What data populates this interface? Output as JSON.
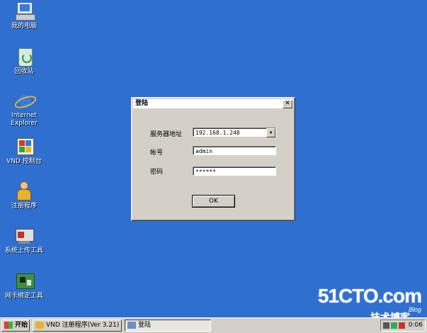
{
  "desktop": {
    "icons": [
      {
        "label": "我的电脑",
        "icon": "my-computer-icon"
      },
      {
        "label": "回收站",
        "icon": "recycle-bin-icon"
      },
      {
        "label": "Internet\nExplorer",
        "icon": "internet-explorer-icon"
      },
      {
        "label": "VND 控制台",
        "icon": "control-console-icon"
      },
      {
        "label": "注册程序",
        "icon": "register-program-icon"
      },
      {
        "label": "系统上传工具",
        "icon": "system-upload-tool-icon"
      },
      {
        "label": "网卡绑定工具",
        "icon": "nic-binding-tool-icon"
      }
    ]
  },
  "dialog": {
    "title": "登陆",
    "close_glyph": "✕",
    "server": {
      "label": "服务器地址",
      "value": "192.168.1.248"
    },
    "account": {
      "label": "帐号",
      "value": "admin"
    },
    "password": {
      "label": "密码",
      "value": "******"
    },
    "ok_label": "OK"
  },
  "taskbar": {
    "start_label": "开始",
    "tasks": [
      {
        "label": "VND 注册程序(Ver 3.21)",
        "active": false
      },
      {
        "label": "登陆",
        "active": true
      }
    ],
    "clock": "0:06"
  },
  "watermark": {
    "main": "51CTO.com",
    "sub": "技术博客",
    "blog": "Blog"
  }
}
